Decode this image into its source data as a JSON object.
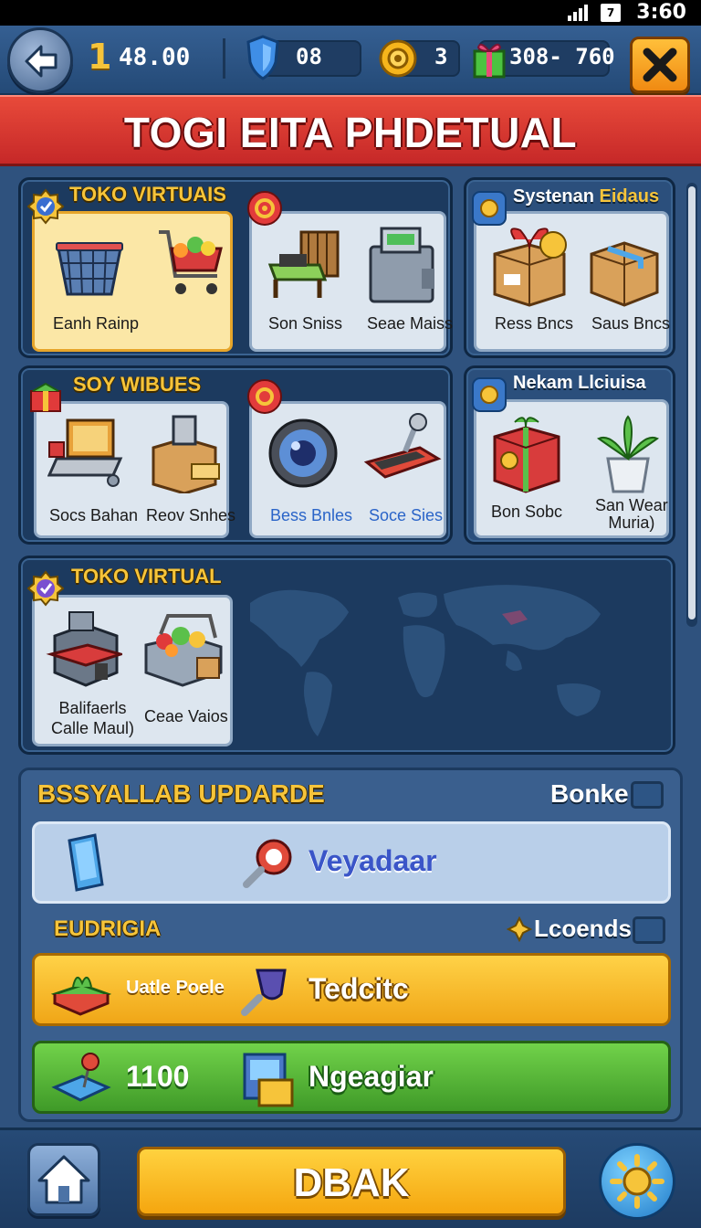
{
  "status_bar": {
    "time": "3:60",
    "battery_glyph": "7"
  },
  "top_bar": {
    "level": "1",
    "coins": "48.00",
    "shield_value": "08",
    "token_value": "3",
    "gift_value": "308- 760"
  },
  "banner": {
    "title": "TOGI EITA PHDETUAL"
  },
  "sections": {
    "toko_virtuais": {
      "title": "TOKO VIRTUAIS",
      "items": [
        "Eanh Rainp",
        "Son Sniss",
        "Seae Maiss"
      ]
    },
    "systenan": {
      "title_white": "Systenan",
      "title_gold": "Eidaus",
      "items": [
        "Ress Bncs",
        "Saus Bncs"
      ]
    },
    "soy_wibues": {
      "title": "SOY WIBUES",
      "items": [
        "Socs Bahan",
        "Reov Snhes",
        "Bess Bnles",
        "Soce Sies"
      ]
    },
    "nekam": {
      "title": "Nekam Llciuisa",
      "items": [
        "Bon Sobc",
        "San Wear",
        "Muria)"
      ]
    },
    "toko_virtual": {
      "title": "TOKO VIRTUAL",
      "items": [
        "Balifaerls",
        "Calle Maul)",
        "Ceae Vaios"
      ]
    }
  },
  "lower": {
    "header_title": "BSSYALLAB UPDARDE",
    "header_toggle_label": "Bonke",
    "row1_text": "Veyadaar",
    "sub_title": "EUDRIGIA",
    "sub_toggle_label": "Lcoends",
    "row2_small": "Uatle Poele",
    "row2_text": "Tedcitc",
    "row3_number": "1100",
    "row3_text": "Ngeagiar"
  },
  "bottom": {
    "main_button": "DBAK"
  },
  "colors": {
    "banner_red": "#d93a2f",
    "accent_gold": "#f6c43a",
    "panel_navy": "#1c3a5f",
    "button_orange": "#f5a60f",
    "button_green": "#4fb232"
  }
}
